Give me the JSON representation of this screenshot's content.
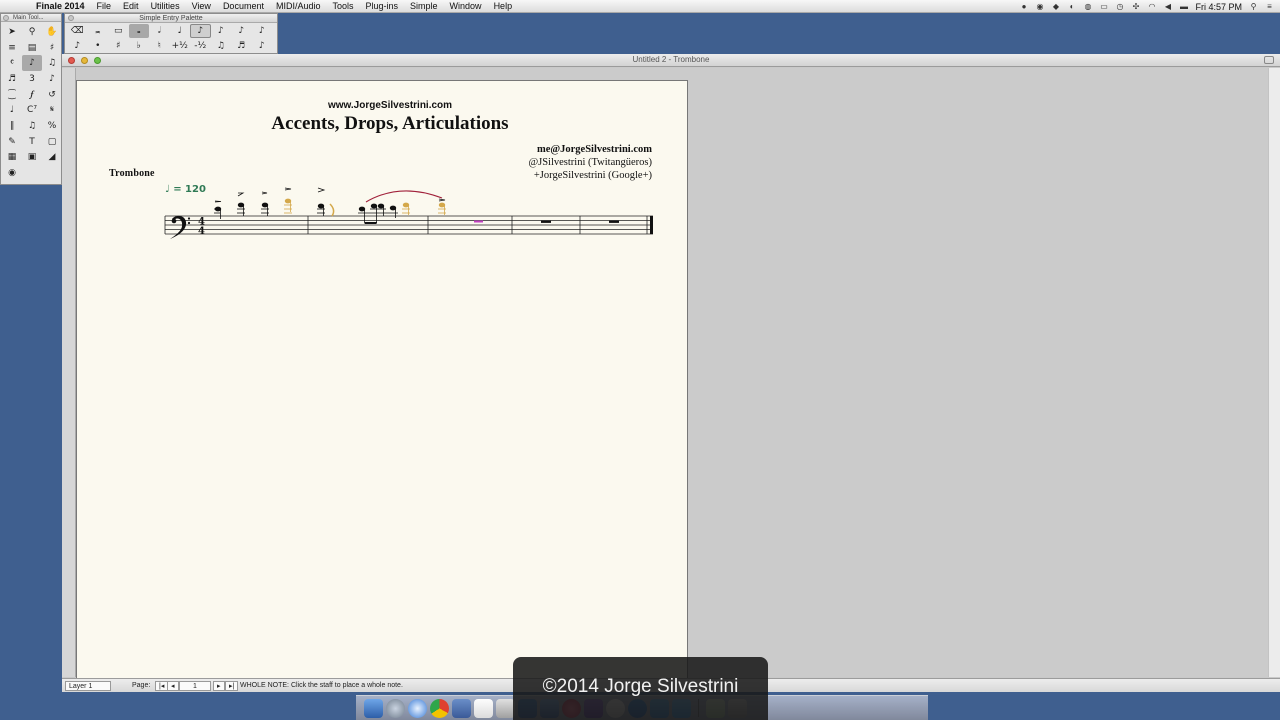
{
  "menubar": {
    "app_name": "Finale 2014",
    "items": [
      "File",
      "Edit",
      "Utilities",
      "View",
      "Document",
      "MIDI/Audio",
      "Tools",
      "Plug-ins",
      "Simple",
      "Window",
      "Help"
    ],
    "clock": "Fri 4:57 PM"
  },
  "palettes": {
    "main_tool_title": "Main Tool...",
    "simple_entry_title": "Simple Entry Palette"
  },
  "window": {
    "title": "Untitled 2 - Trombone"
  },
  "score": {
    "url": "www.JorgeSilvestrini.com",
    "title": "Accents, Drops, Articulations",
    "email": "me@JorgeSilvestrini.com",
    "twitter": "@JSilvestrini (Twitangüeros)",
    "google": "+JorgeSilvestrini (Google+)",
    "instrument": "Trombone",
    "tempo": "♩ = 120",
    "time_signature_top": "4",
    "time_signature_bottom": "4"
  },
  "statusbar": {
    "layer": "Layer 1",
    "page_label": "Page:",
    "page_number": "1",
    "message": "WHOLE NOTE: Click the staff to place a whole note."
  },
  "watermark": "©2014 Jorge Silvestrini",
  "colors": {
    "desktop": "#3f5f8f",
    "page": "#fbf9ef",
    "tempo": "#2f7a55",
    "slur": "#a0203a",
    "highlight_note": "#d4a84a",
    "rest_highlight": "#c23fc2"
  }
}
